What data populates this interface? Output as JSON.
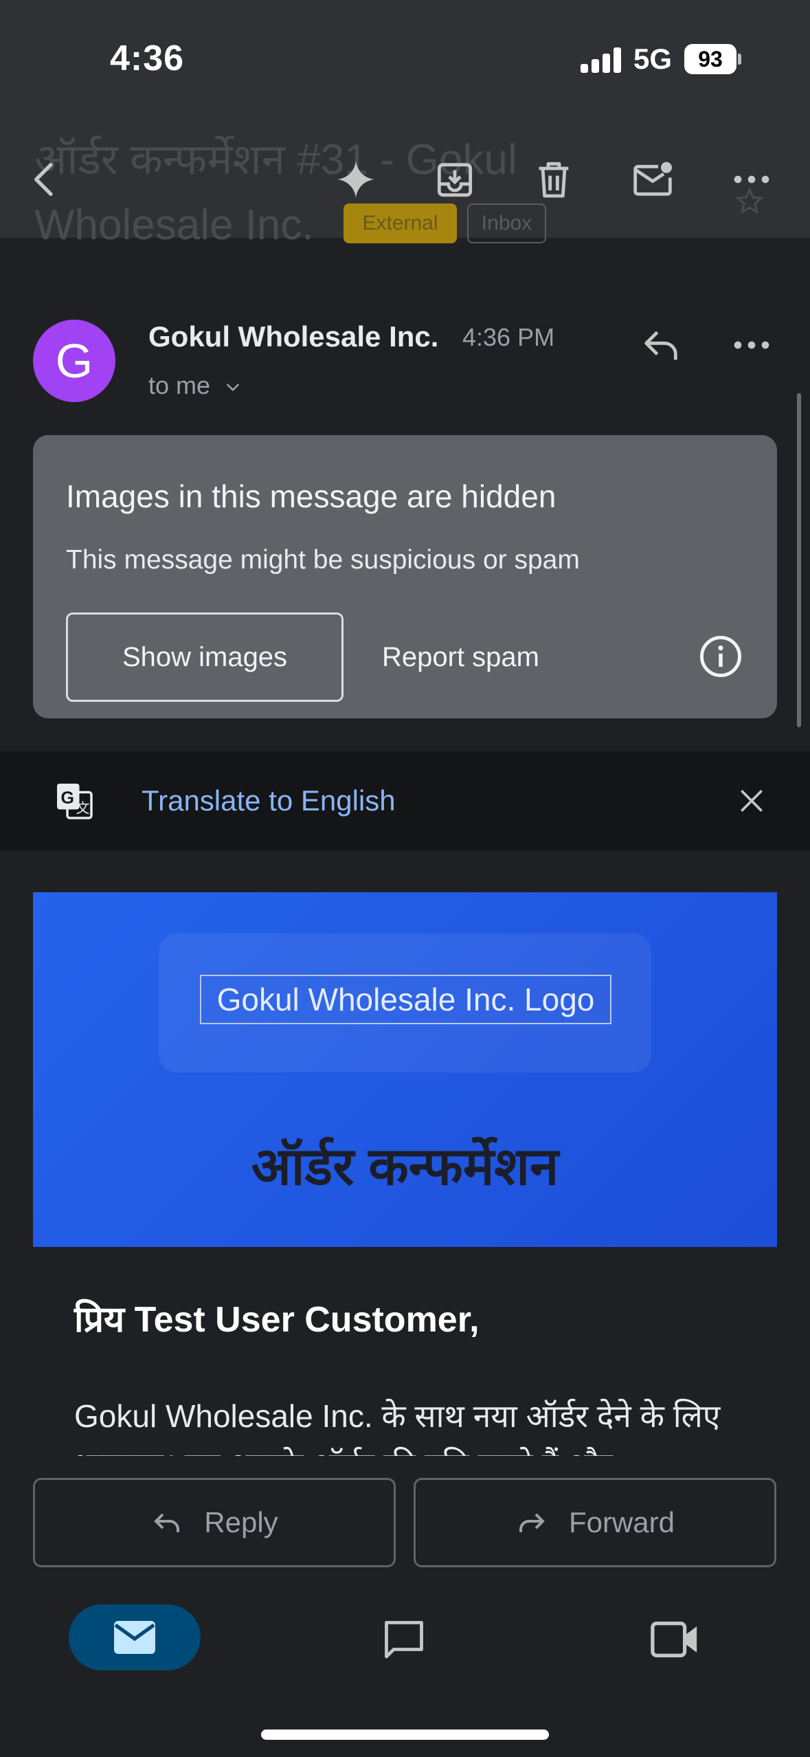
{
  "status_bar": {
    "time": "4:36",
    "network": "5G",
    "battery": "93"
  },
  "toolbar": {
    "back": "back-arrow-icon",
    "gemini": "sparkle-icon",
    "archive": "archive-icon",
    "delete": "trash-icon",
    "mark_unread": "mail-unread-icon",
    "more": "more-horizontal-icon"
  },
  "subject": {
    "text": "ऑर्डर कन्फर्मेशन #31 - Gokul Wholesale Inc.",
    "labels": [
      "External",
      "Inbox"
    ]
  },
  "message": {
    "avatar_letter": "G",
    "avatar_color": "#a142f4",
    "sender": "Gokul Wholesale Inc.",
    "time": "4:36 PM",
    "recipient": "to me"
  },
  "warning": {
    "title": "Images in this message are hidden",
    "subtitle": "This message might be suspicious or spam",
    "show_images": "Show images",
    "report_spam": "Report spam"
  },
  "translate": {
    "label": "Translate to English"
  },
  "email": {
    "logo_alt": "Gokul Wholesale Inc. Logo",
    "banner_title": "ऑर्डर कन्फर्मेशन",
    "banner_color": "#2563eb",
    "greeting": "प्रिय Test User Customer,",
    "body": "Gokul Wholesale Inc. के साथ नया ऑर्डर देने के लिए धन्यवाद। हम आपके ऑर्डर की पुष्टि करते हैं और"
  },
  "actions": {
    "reply": "Reply",
    "forward": "Forward"
  },
  "bottom_nav": {
    "mail": "mail-icon",
    "chat": "chat-icon",
    "meet": "video-icon"
  }
}
